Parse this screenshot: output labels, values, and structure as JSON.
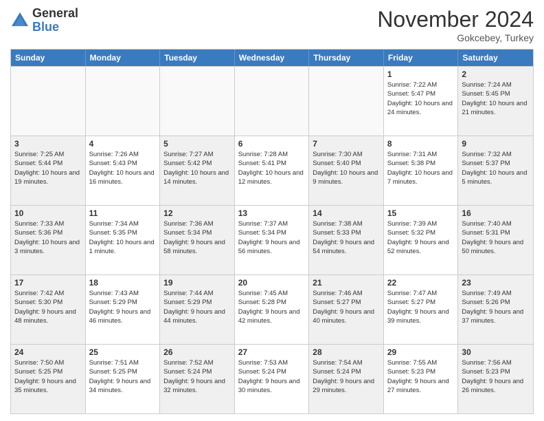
{
  "header": {
    "logo_general": "General",
    "logo_blue": "Blue",
    "month_title": "November 2024",
    "subtitle": "Gokcebey, Turkey"
  },
  "days_of_week": [
    "Sunday",
    "Monday",
    "Tuesday",
    "Wednesday",
    "Thursday",
    "Friday",
    "Saturday"
  ],
  "weeks": [
    [
      {
        "day": "",
        "info": ""
      },
      {
        "day": "",
        "info": ""
      },
      {
        "day": "",
        "info": ""
      },
      {
        "day": "",
        "info": ""
      },
      {
        "day": "",
        "info": ""
      },
      {
        "day": "1",
        "info": "Sunrise: 7:22 AM\nSunset: 5:47 PM\nDaylight: 10 hours and 24 minutes."
      },
      {
        "day": "2",
        "info": "Sunrise: 7:24 AM\nSunset: 5:45 PM\nDaylight: 10 hours and 21 minutes."
      }
    ],
    [
      {
        "day": "3",
        "info": "Sunrise: 7:25 AM\nSunset: 5:44 PM\nDaylight: 10 hours and 19 minutes."
      },
      {
        "day": "4",
        "info": "Sunrise: 7:26 AM\nSunset: 5:43 PM\nDaylight: 10 hours and 16 minutes."
      },
      {
        "day": "5",
        "info": "Sunrise: 7:27 AM\nSunset: 5:42 PM\nDaylight: 10 hours and 14 minutes."
      },
      {
        "day": "6",
        "info": "Sunrise: 7:28 AM\nSunset: 5:41 PM\nDaylight: 10 hours and 12 minutes."
      },
      {
        "day": "7",
        "info": "Sunrise: 7:30 AM\nSunset: 5:40 PM\nDaylight: 10 hours and 9 minutes."
      },
      {
        "day": "8",
        "info": "Sunrise: 7:31 AM\nSunset: 5:38 PM\nDaylight: 10 hours and 7 minutes."
      },
      {
        "day": "9",
        "info": "Sunrise: 7:32 AM\nSunset: 5:37 PM\nDaylight: 10 hours and 5 minutes."
      }
    ],
    [
      {
        "day": "10",
        "info": "Sunrise: 7:33 AM\nSunset: 5:36 PM\nDaylight: 10 hours and 3 minutes."
      },
      {
        "day": "11",
        "info": "Sunrise: 7:34 AM\nSunset: 5:35 PM\nDaylight: 10 hours and 1 minute."
      },
      {
        "day": "12",
        "info": "Sunrise: 7:36 AM\nSunset: 5:34 PM\nDaylight: 9 hours and 58 minutes."
      },
      {
        "day": "13",
        "info": "Sunrise: 7:37 AM\nSunset: 5:34 PM\nDaylight: 9 hours and 56 minutes."
      },
      {
        "day": "14",
        "info": "Sunrise: 7:38 AM\nSunset: 5:33 PM\nDaylight: 9 hours and 54 minutes."
      },
      {
        "day": "15",
        "info": "Sunrise: 7:39 AM\nSunset: 5:32 PM\nDaylight: 9 hours and 52 minutes."
      },
      {
        "day": "16",
        "info": "Sunrise: 7:40 AM\nSunset: 5:31 PM\nDaylight: 9 hours and 50 minutes."
      }
    ],
    [
      {
        "day": "17",
        "info": "Sunrise: 7:42 AM\nSunset: 5:30 PM\nDaylight: 9 hours and 48 minutes."
      },
      {
        "day": "18",
        "info": "Sunrise: 7:43 AM\nSunset: 5:29 PM\nDaylight: 9 hours and 46 minutes."
      },
      {
        "day": "19",
        "info": "Sunrise: 7:44 AM\nSunset: 5:29 PM\nDaylight: 9 hours and 44 minutes."
      },
      {
        "day": "20",
        "info": "Sunrise: 7:45 AM\nSunset: 5:28 PM\nDaylight: 9 hours and 42 minutes."
      },
      {
        "day": "21",
        "info": "Sunrise: 7:46 AM\nSunset: 5:27 PM\nDaylight: 9 hours and 40 minutes."
      },
      {
        "day": "22",
        "info": "Sunrise: 7:47 AM\nSunset: 5:27 PM\nDaylight: 9 hours and 39 minutes."
      },
      {
        "day": "23",
        "info": "Sunrise: 7:49 AM\nSunset: 5:26 PM\nDaylight: 9 hours and 37 minutes."
      }
    ],
    [
      {
        "day": "24",
        "info": "Sunrise: 7:50 AM\nSunset: 5:25 PM\nDaylight: 9 hours and 35 minutes."
      },
      {
        "day": "25",
        "info": "Sunrise: 7:51 AM\nSunset: 5:25 PM\nDaylight: 9 hours and 34 minutes."
      },
      {
        "day": "26",
        "info": "Sunrise: 7:52 AM\nSunset: 5:24 PM\nDaylight: 9 hours and 32 minutes."
      },
      {
        "day": "27",
        "info": "Sunrise: 7:53 AM\nSunset: 5:24 PM\nDaylight: 9 hours and 30 minutes."
      },
      {
        "day": "28",
        "info": "Sunrise: 7:54 AM\nSunset: 5:24 PM\nDaylight: 9 hours and 29 minutes."
      },
      {
        "day": "29",
        "info": "Sunrise: 7:55 AM\nSunset: 5:23 PM\nDaylight: 9 hours and 27 minutes."
      },
      {
        "day": "30",
        "info": "Sunrise: 7:56 AM\nSunset: 5:23 PM\nDaylight: 9 hours and 26 minutes."
      }
    ]
  ]
}
